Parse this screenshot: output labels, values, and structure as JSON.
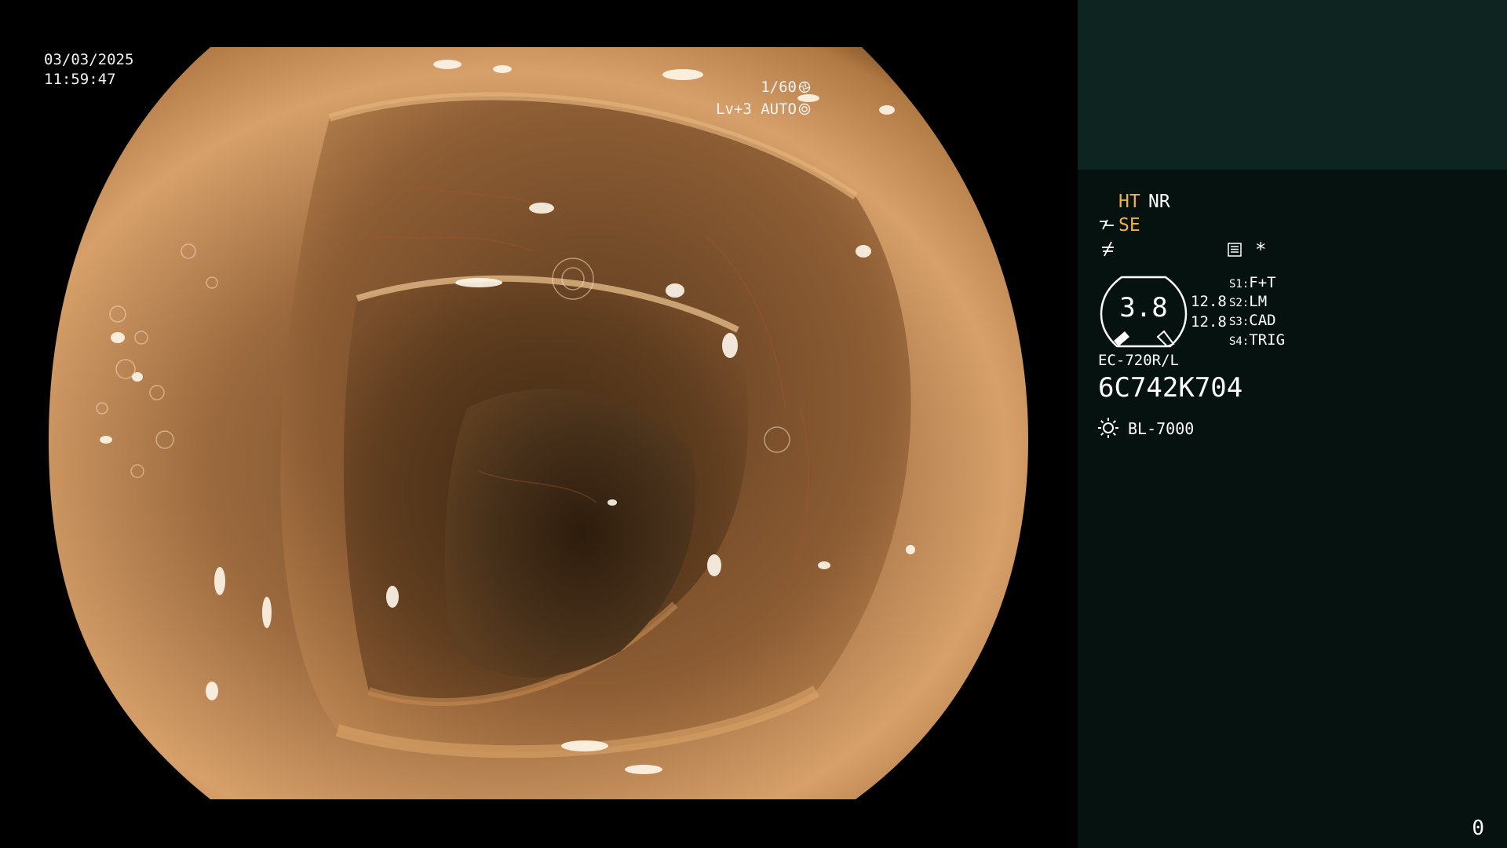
{
  "overlay": {
    "date": "03/03/2025",
    "time": "11:59:47",
    "shutter": "1/60",
    "iris_level": "Lv+3 AUTO"
  },
  "panel": {
    "ht": "HT",
    "nr": "NR",
    "se": "SE",
    "asterisk": "*",
    "zoom": "3.8",
    "ratio_top": "12.8",
    "ratio_bottom": "12.8",
    "switches": [
      {
        "key": "S1:",
        "value": "F+T"
      },
      {
        "key": "S2:",
        "value": "LM"
      },
      {
        "key": "S3:",
        "value": "CAD"
      },
      {
        "key": "S4:",
        "value": "TRIG"
      }
    ],
    "scope_model": "EC-720R/L",
    "scope_serial": "6C742K704",
    "light_source": "BL-7000",
    "frame_count": "0"
  },
  "colors": {
    "panel_bg": "#06120f",
    "thumbnail_bg": "#0d2421",
    "accent": "#f0b43a",
    "tissue": "#c2844f"
  },
  "icons": {
    "shutter": "aperture-icon",
    "iris": "iris-icon",
    "se": "structure-enhance-icon",
    "enhancement": "edge-enhance-icon",
    "memo": "memo-icon",
    "light": "light-source-icon"
  }
}
